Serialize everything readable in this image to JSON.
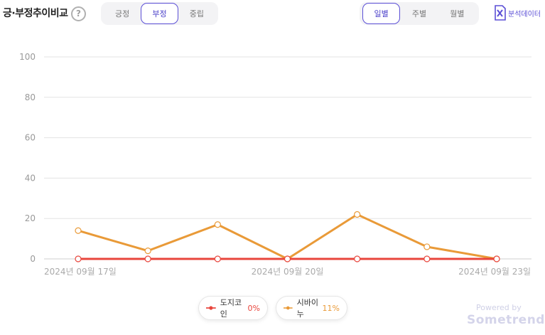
{
  "header": {
    "title": "긍·부정추이비교",
    "help_symbol": "?",
    "sentiment_tabs": [
      "긍정",
      "부정",
      "중립"
    ],
    "sentiment_active": 1,
    "period_tabs": [
      "일별",
      "주별",
      "월별"
    ],
    "period_active": 0,
    "export_label": "분석데이터"
  },
  "chart_data": {
    "type": "line",
    "x": [
      "2024-09-17",
      "2024-09-18",
      "2024-09-19",
      "2024-09-20",
      "2024-09-21",
      "2024-09-22",
      "2024-09-23"
    ],
    "x_tick_labels": [
      "2024년 09월 17일",
      "2024년 09월 20일",
      "2024년 09월 23일"
    ],
    "x_tick_index": [
      0,
      3,
      6
    ],
    "ylim": [
      0,
      100
    ],
    "yticks": [
      0,
      20,
      40,
      60,
      80,
      100
    ],
    "grid": true,
    "legend_position": "bottom",
    "series": [
      {
        "name": "도지코인",
        "percent": "0%",
        "color": "#e8453c",
        "values": [
          0,
          0,
          0,
          0,
          0,
          0,
          0
        ]
      },
      {
        "name": "시바이누",
        "percent": "11%",
        "color": "#e99a38",
        "values": [
          14,
          4,
          17,
          0,
          22,
          6,
          0
        ]
      }
    ]
  },
  "footer": {
    "powered_by": "Powered by",
    "brand": "Sometrend"
  },
  "colors": {
    "accent": "#5b4fd6",
    "grid": "#e3e3e3"
  }
}
